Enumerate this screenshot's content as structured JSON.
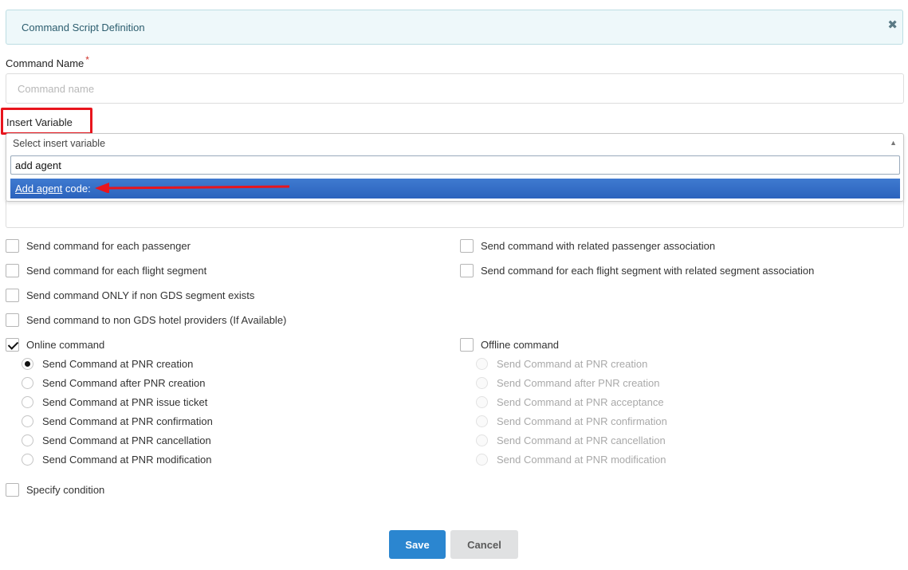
{
  "header": {
    "title": "Command Script Definition",
    "close_icon": "close-icon"
  },
  "command_name": {
    "label": "Command Name",
    "required_mark": "*",
    "placeholder": "Command name",
    "value": ""
  },
  "insert_variable": {
    "label": "Insert Variable",
    "selected": "Select insert variable",
    "search_value": "add agent",
    "option_match": "Add agent",
    "option_rest": " code:"
  },
  "options": {
    "left": [
      "Send command for each passenger",
      "Send command for each flight segment",
      "Send command ONLY if non GDS segment exists",
      "Send command to non GDS hotel providers (If Available)"
    ],
    "right": [
      "Send command with related passenger association",
      "Send command for each flight segment with related segment association"
    ]
  },
  "online": {
    "label": "Online command",
    "checked": true,
    "radios": [
      "Send Command at PNR creation",
      "Send Command after PNR creation",
      "Send Command at PNR issue ticket",
      "Send Command at PNR confirmation",
      "Send Command at PNR cancellation",
      "Send Command at PNR modification"
    ],
    "selected_index": 0
  },
  "offline": {
    "label": "Offline command",
    "checked": false,
    "radios": [
      "Send Command at PNR creation",
      "Send Command after PNR creation",
      "Send Command at PNR acceptance",
      "Send Command at PNR confirmation",
      "Send Command at PNR cancellation",
      "Send Command at PNR modification"
    ]
  },
  "specify_condition": {
    "label": "Specify condition",
    "checked": false
  },
  "buttons": {
    "save": "Save",
    "cancel": "Cancel"
  },
  "colors": {
    "primary": "#2b86d0",
    "highlight": "#e8151d",
    "option_bg": "#2b63bd"
  }
}
